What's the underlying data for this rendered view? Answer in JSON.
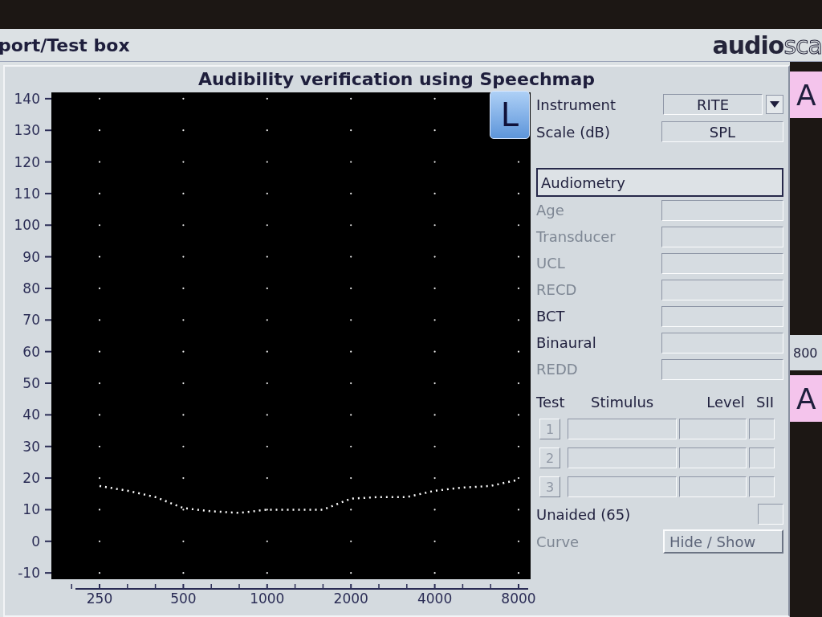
{
  "header": {
    "title": "port/Test box",
    "logo": {
      "bold": "audio",
      "outline": "sca"
    }
  },
  "panel": {
    "title": "Audibility verification using Speechmap"
  },
  "chart": {
    "ear_badge": "L",
    "chart_data": {
      "type": "line",
      "categories": [
        "250",
        null,
        null,
        "500",
        null,
        null,
        "1000",
        null,
        null,
        "2000",
        null,
        null,
        "4000",
        null,
        null,
        "8000"
      ],
      "series": [
        {
          "color": "#ffffff",
          "line_style": "dotted",
          "values": [
            17.5,
            16,
            14,
            10.5,
            9.5,
            9,
            10,
            10,
            10,
            13.5,
            14,
            14,
            16,
            17,
            17.5,
            19.5
          ]
        }
      ],
      "ylim": [
        -12,
        142
      ],
      "yticks": [
        -10,
        0,
        10,
        20,
        30,
        40,
        50,
        60,
        70,
        80,
        90,
        100,
        110,
        120,
        130,
        140
      ]
    }
  },
  "settings": [
    {
      "label": "Instrument",
      "value": "RITE",
      "kind": "dropdown"
    },
    {
      "label": "Scale (dB)",
      "value": "SPL",
      "kind": "display"
    }
  ],
  "audiometry": {
    "label": "Audiometry",
    "fields": [
      {
        "label": "Age",
        "disabled": true
      },
      {
        "label": "Transducer",
        "disabled": true
      },
      {
        "label": "UCL",
        "disabled": true
      },
      {
        "label": "RECD",
        "disabled": true
      },
      {
        "label": "BCT",
        "disabled": false
      },
      {
        "label": "Binaural",
        "disabled": false
      },
      {
        "label": "REDD",
        "disabled": true
      }
    ]
  },
  "tests": {
    "columns": [
      "Test",
      "Stimulus",
      "Level",
      "SII"
    ],
    "rows": [
      {
        "number": "1",
        "disabled": true
      },
      {
        "number": "2",
        "disabled": true
      },
      {
        "number": "3",
        "disabled": true
      }
    ],
    "unaided": "Unaided (65)"
  },
  "curve": {
    "label": "Curve",
    "button": "Hide / Show",
    "disabled": true
  },
  "side": {
    "tabs": [
      "A",
      "A"
    ],
    "axis_label": "800"
  }
}
